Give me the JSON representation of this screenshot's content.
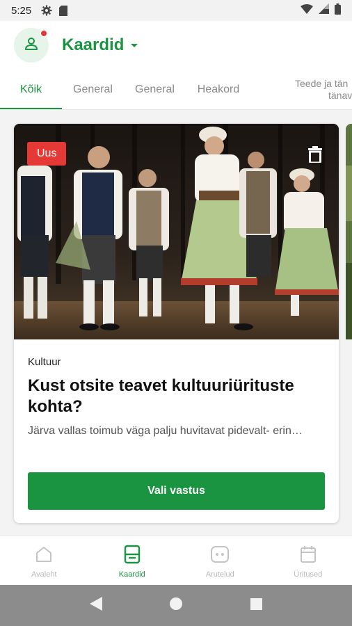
{
  "status_bar": {
    "time": "5:25",
    "icons_left": [
      "gear-icon",
      "sd-card-icon"
    ],
    "icons_right": [
      "wifi-icon",
      "cell-signal-icon",
      "battery-icon"
    ]
  },
  "app_bar": {
    "title": "Kaardid",
    "avatar_icon": "user-icon",
    "notification_dot": true
  },
  "tabs": [
    {
      "label": "Kõik",
      "active": true
    },
    {
      "label": "General",
      "active": false
    },
    {
      "label": "General",
      "active": false
    },
    {
      "label": "Heakord",
      "active": false
    },
    {
      "label_line1": "Teede ja tän",
      "label_line2": "tänava",
      "active": false
    }
  ],
  "card": {
    "badge": "Uus",
    "category": "Kultuur",
    "title": "Kust otsite teavet kultuuriürituste kohta?",
    "description": "Järva vallas toimub väga palju huvitavat pidevalt- erin…",
    "button_label": "Vali vastus",
    "delete_icon": "trash-icon"
  },
  "bottom_nav": [
    {
      "label": "Avaleht",
      "icon": "home-icon",
      "active": false
    },
    {
      "label": "Kaardid",
      "icon": "cards-icon",
      "active": true
    },
    {
      "label": "Arutelud",
      "icon": "discussion-icon",
      "active": false
    },
    {
      "label": "Üritused",
      "icon": "calendar-icon",
      "active": false
    }
  ],
  "system_nav": [
    "back-icon",
    "home-circle-icon",
    "recents-icon"
  ],
  "colors": {
    "accent": "#1a9440",
    "badge_red": "#e53935",
    "inactive": "#b9b9b9",
    "tab_inactive": "#8a8a8a"
  }
}
